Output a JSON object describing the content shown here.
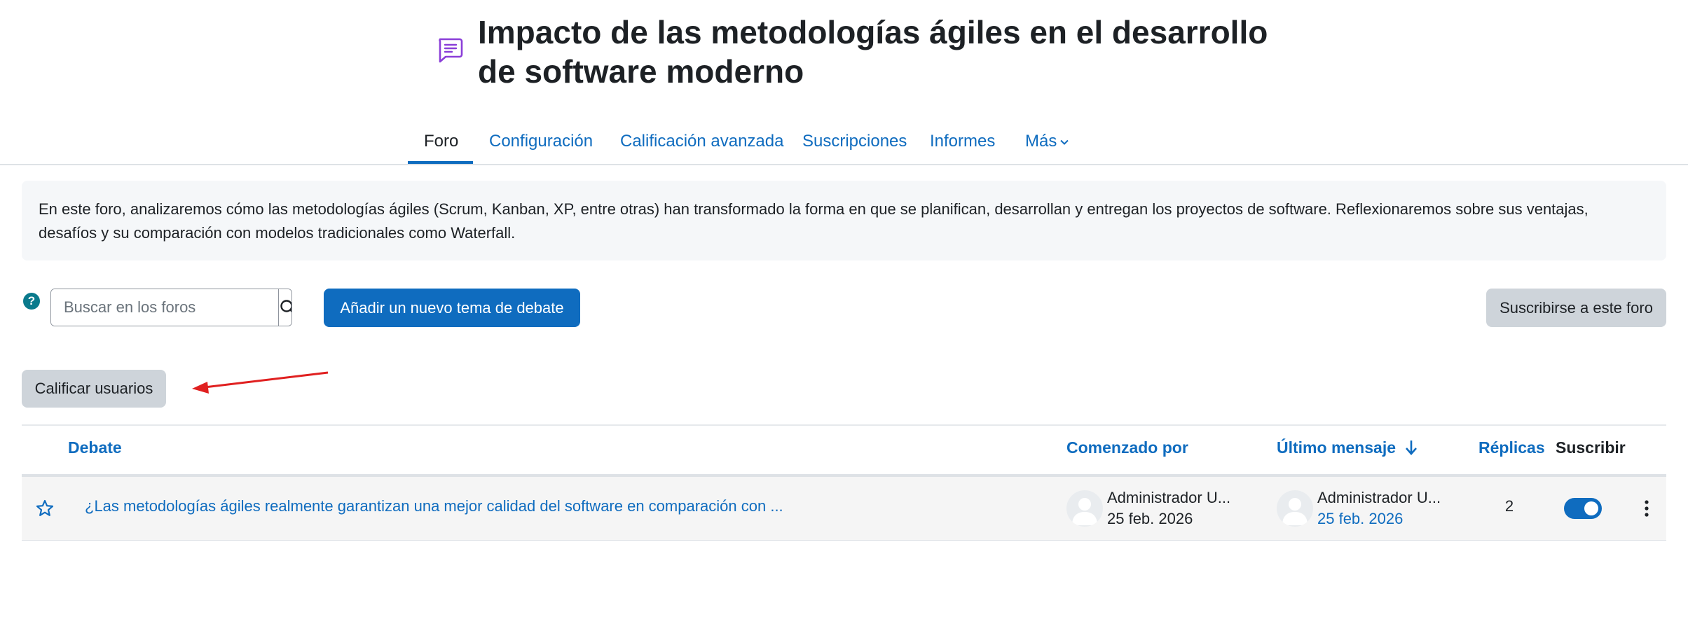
{
  "page": {
    "title": "Impacto de las metodologías ágiles en el desarrollo de software moderno"
  },
  "nav": {
    "tabs": [
      {
        "label": "Foro",
        "active": true
      },
      {
        "label": "Configuración"
      },
      {
        "label": "Calificación avanzada"
      },
      {
        "label": "Suscripciones"
      },
      {
        "label": "Informes"
      },
      {
        "label": "Más"
      }
    ]
  },
  "intro": {
    "text": "En este foro, analizaremos cómo las metodologías ágiles (Scrum, Kanban, XP, entre otras) han transformado la forma en que se planifican, desarrollan y entregan los proyectos de software. Reflexionaremos sobre sus ventajas, desafíos y su comparación con modelos tradicionales como Waterfall."
  },
  "toolbar": {
    "help_label": "?",
    "search_placeholder": "Buscar en los foros",
    "add_topic_label": "Añadir un nuevo tema de debate",
    "subscribe_label": "Suscribirse a este foro",
    "grade_users_label": "Calificar usuarios"
  },
  "table": {
    "headers": {
      "discussion": "Debate",
      "started_by": "Comenzado por",
      "last_post": "Último mensaje",
      "replies": "Réplicas",
      "subscribe": "Suscribir"
    },
    "rows": [
      {
        "title": "¿Las metodologías ágiles realmente garantizan una mejor calidad del software en comparación con ...",
        "started_by_name": "Administrador U...",
        "started_by_date": "25 feb. 2026",
        "last_post_name": "Administrador U...",
        "last_post_date": "25 feb. 2026",
        "replies": "2",
        "subscribed": true
      }
    ]
  },
  "colors": {
    "primary": "#0f6cbf",
    "annotation_arrow": "#e02020",
    "secondary_button": "#ced4da"
  },
  "icons": [
    "forum-icon",
    "help-icon",
    "search-icon",
    "chevron-down-icon",
    "star-icon",
    "avatar-icon",
    "sort-down-arrow-icon",
    "kebab-menu-icon"
  ]
}
